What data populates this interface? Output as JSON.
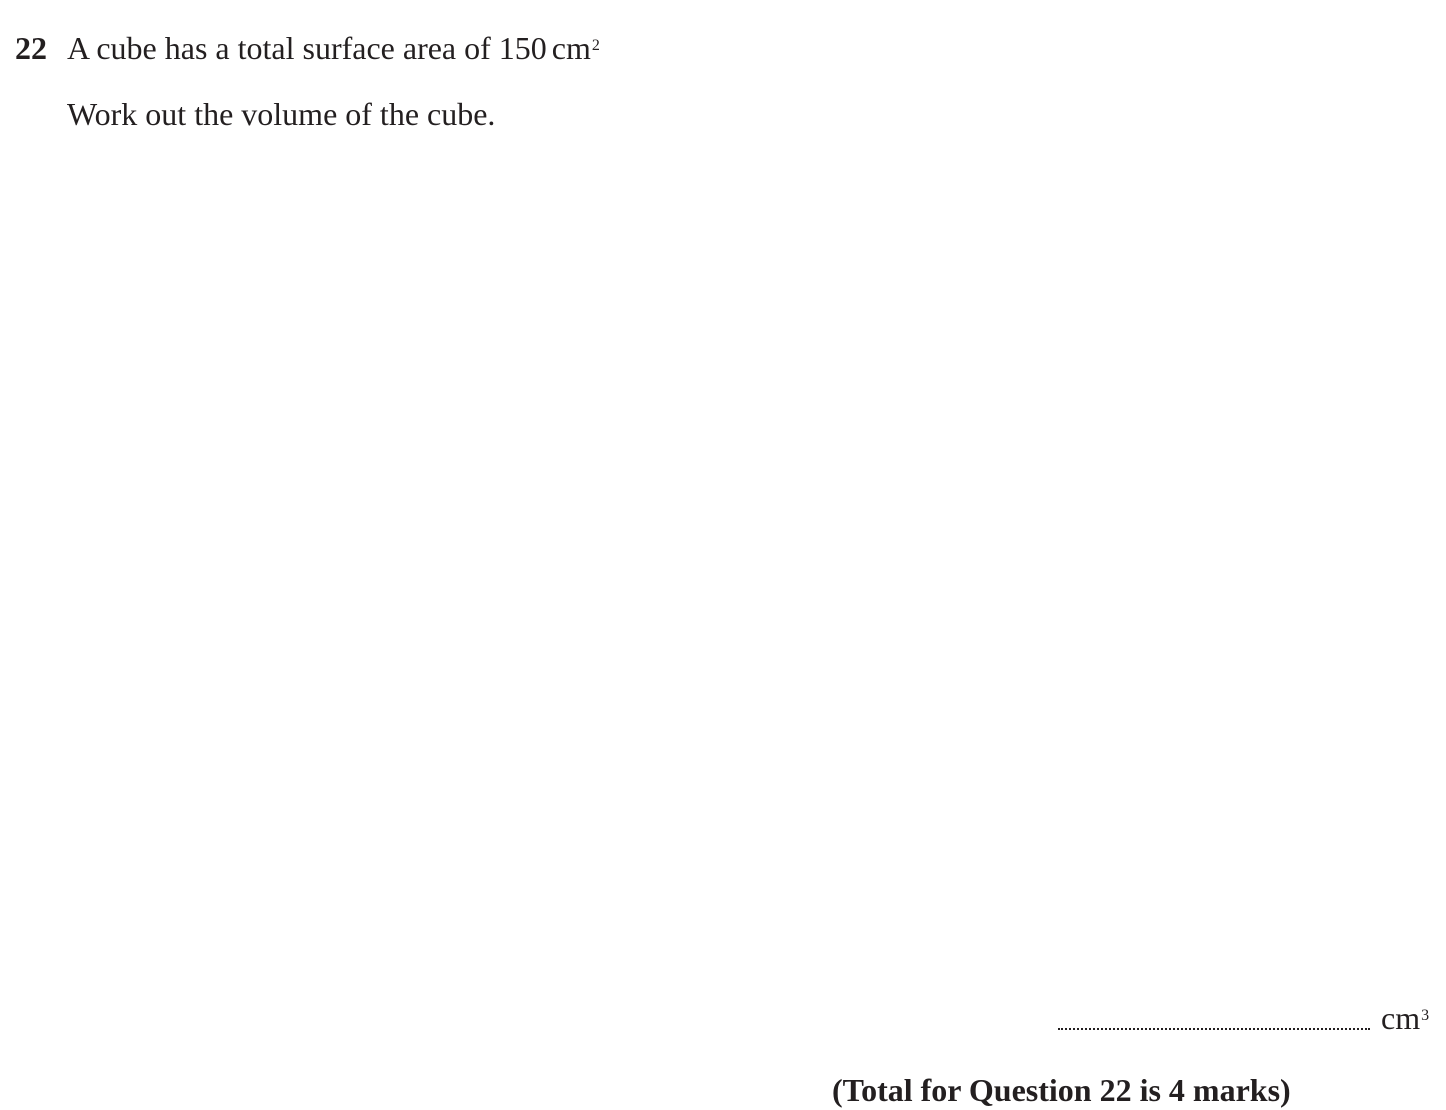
{
  "question": {
    "number": "22",
    "statement_text": "A cube has a total surface area of 150",
    "statement_unit": "cm",
    "statement_unit_power": "2",
    "instruction": "Work out the volume of the cube."
  },
  "answer": {
    "unit": "cm",
    "unit_power": "3"
  },
  "total_marks_text": "(Total for Question 22 is 4 marks)"
}
